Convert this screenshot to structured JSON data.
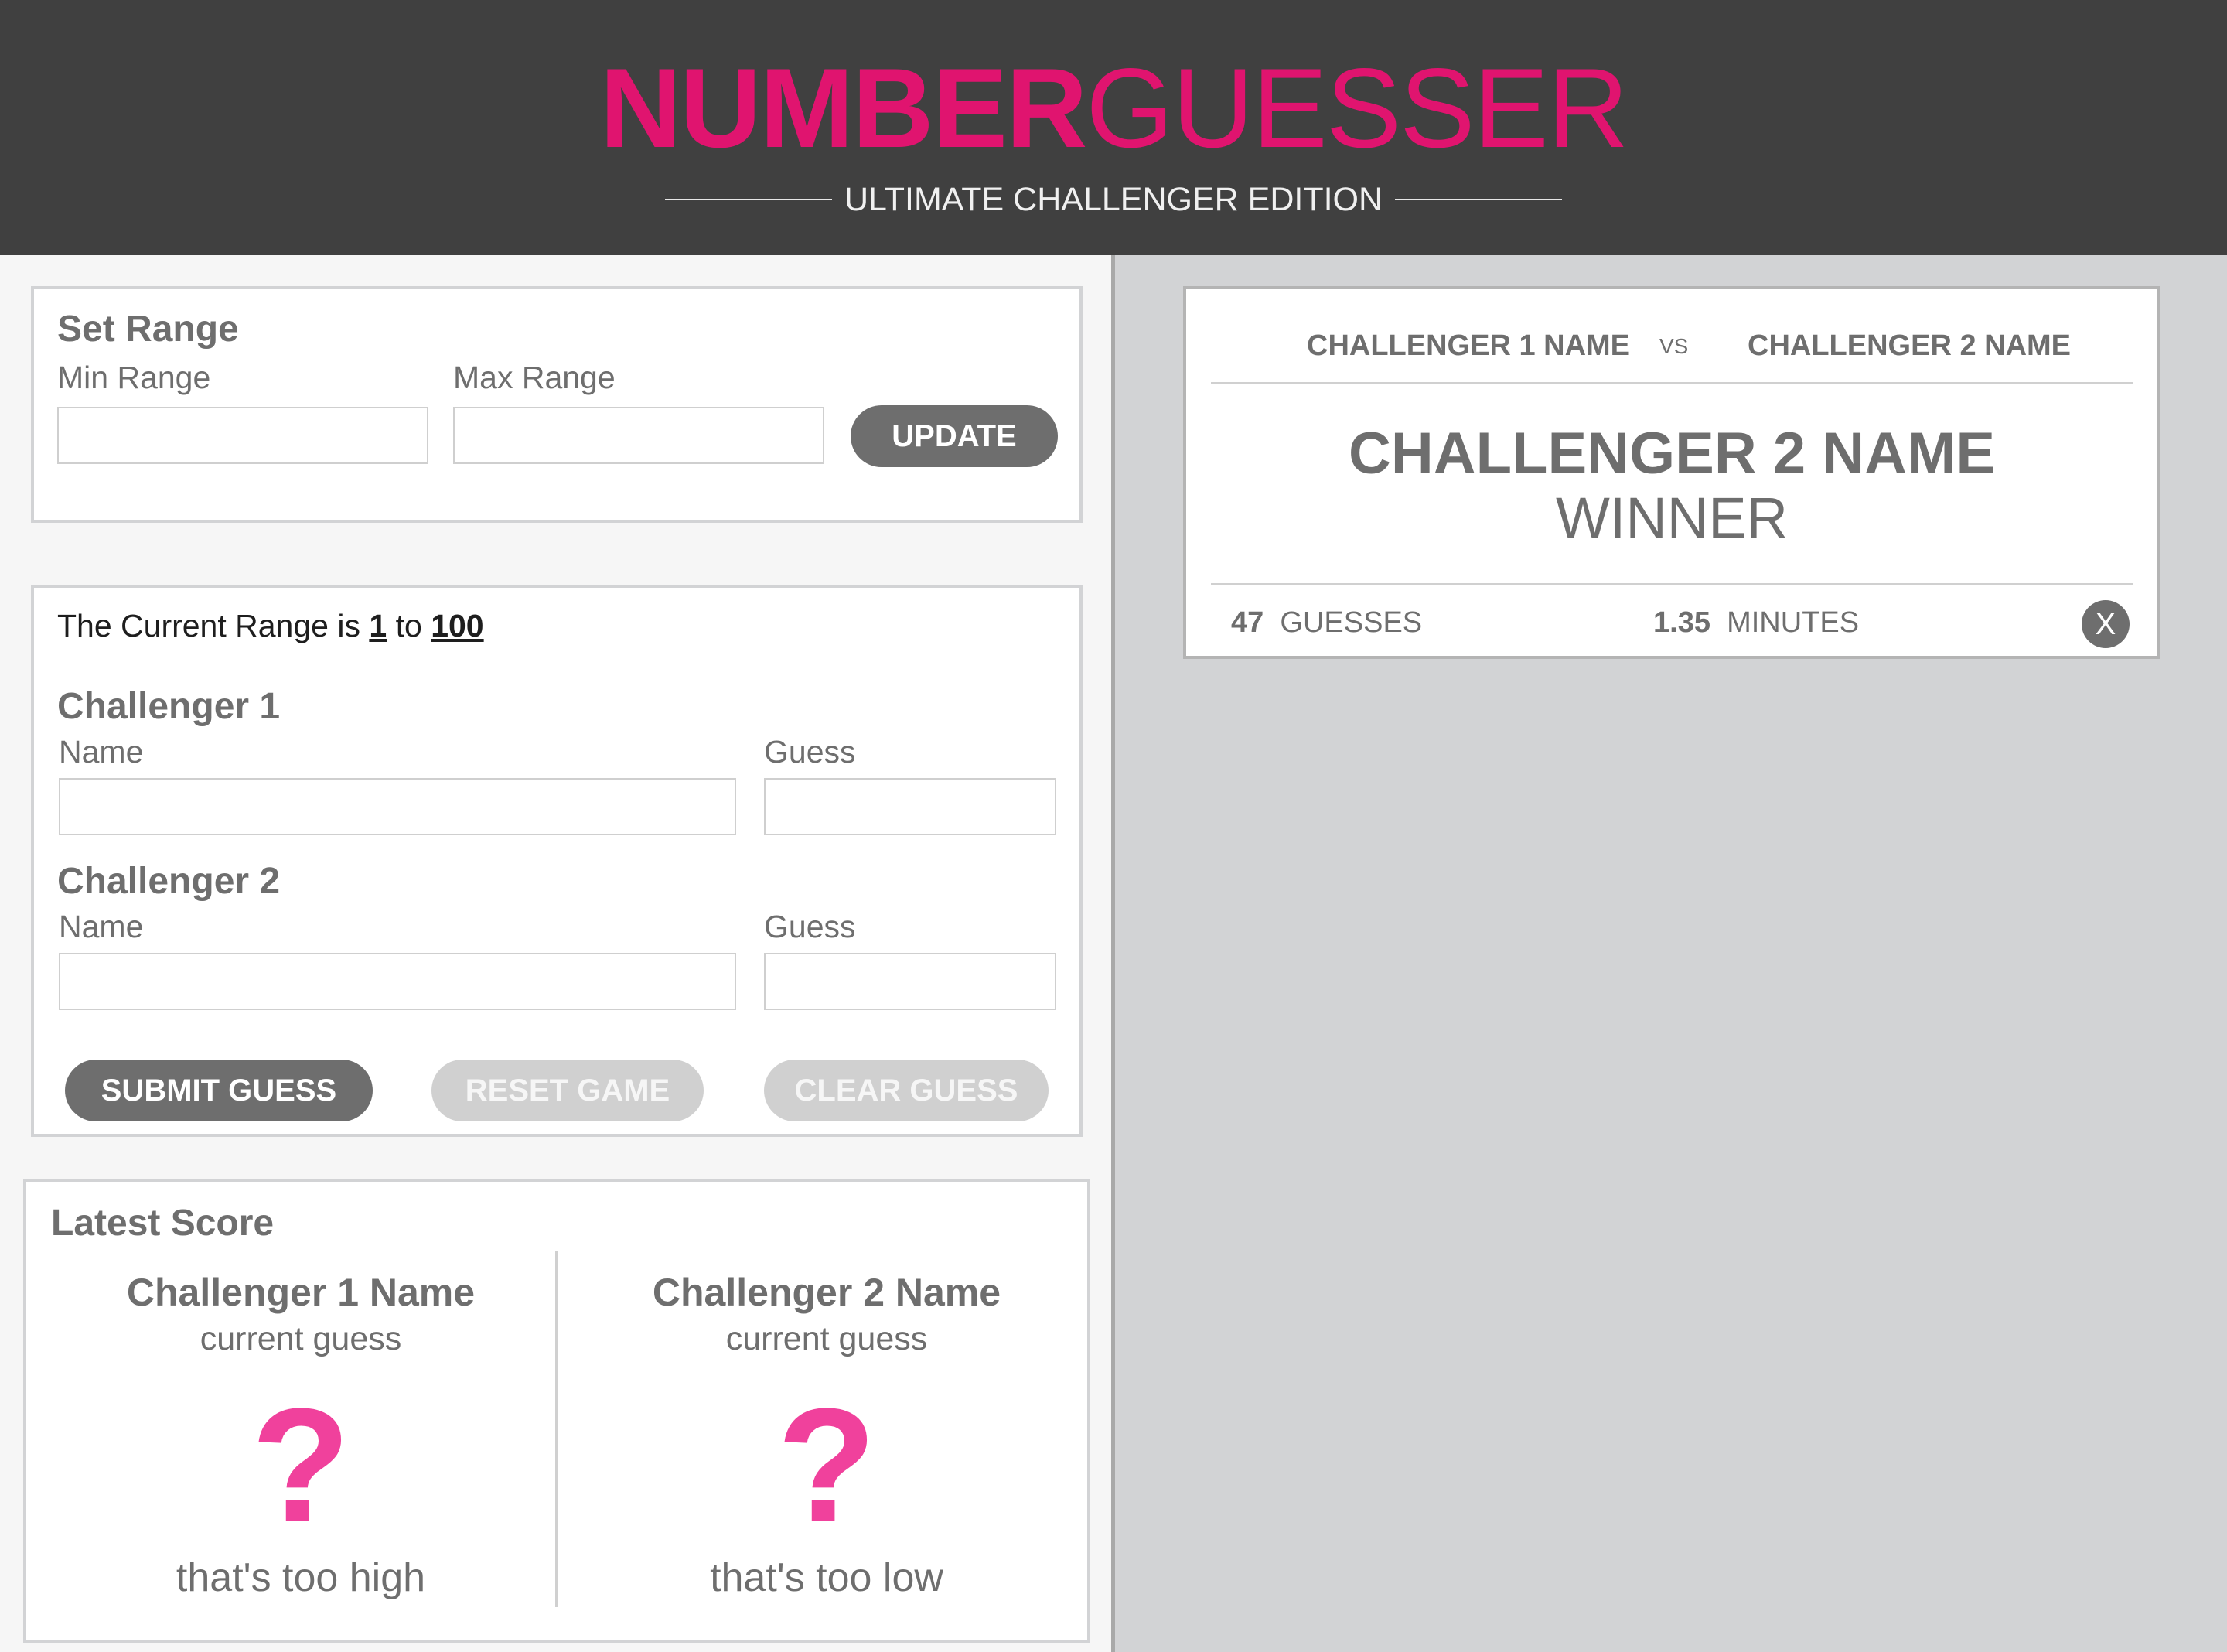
{
  "header": {
    "logo_bold": "NUMBER",
    "logo_light": "GUESSER",
    "subtitle": "ULTIMATE CHALLENGER EDITION"
  },
  "set_range": {
    "title": "Set Range",
    "min_label": "Min Range",
    "max_label": "Max Range",
    "min_value": "",
    "max_value": "",
    "update_label": "UPDATE"
  },
  "guess_form": {
    "range_prefix": "The Current Range is",
    "range_min": "1",
    "range_to": "to",
    "range_max": "100",
    "challenger1": {
      "title": "Challenger 1",
      "name_label": "Name",
      "guess_label": "Guess",
      "name_value": "",
      "guess_value": ""
    },
    "challenger2": {
      "title": "Challenger 2",
      "name_label": "Name",
      "guess_label": "Guess",
      "name_value": "",
      "guess_value": ""
    },
    "submit_label": "SUBMIT GUESS",
    "reset_label": "RESET GAME",
    "clear_label": "CLEAR GUESS"
  },
  "latest_score": {
    "title": "Latest Score",
    "c1_name": "Challenger 1 Name",
    "c1_sub": "current guess",
    "c1_guess": "?",
    "c1_feedback": "that's too high",
    "c2_name": "Challenger 2 Name",
    "c2_sub": "current guess",
    "c2_guess": "?",
    "c2_feedback": "that's too low"
  },
  "result_card": {
    "challenger1": "CHALLENGER 1 NAME",
    "vs": "VS",
    "challenger2": "CHALLENGER 2 NAME",
    "winner_name": "CHALLENGER 2 NAME",
    "winner_label": "WINNER",
    "guesses_count": "47",
    "guesses_label": "GUESSES",
    "minutes_count": "1.35",
    "minutes_label": "MINUTES",
    "close_label": "X"
  },
  "colors": {
    "accent": "#e0146f",
    "question_mark": "#f0419c",
    "header_bg": "#404040",
    "text": "#6e6e6e"
  }
}
